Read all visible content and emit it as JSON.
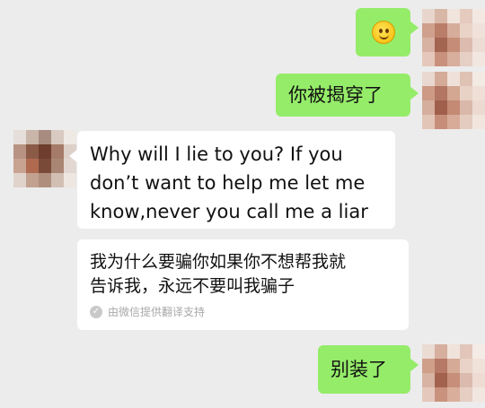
{
  "chat": {
    "messages": [
      {
        "side": "right",
        "type": "emoji",
        "emoji": "smile-emoji"
      },
      {
        "side": "right",
        "type": "text",
        "text": "你被揭穿了"
      },
      {
        "side": "left",
        "type": "text",
        "lines": [
          "Why will I lie to you? If you",
          "don’t want to help me let me",
          "know,never you call me a liar"
        ]
      },
      {
        "side": "left",
        "type": "translation",
        "lines": [
          "我为什么要骗你如果你不想帮我就",
          "告诉我，永远不要叫我骗子"
        ],
        "caption": "由微信提供翻译支持"
      },
      {
        "side": "right",
        "type": "text",
        "text": "别装了"
      }
    ]
  },
  "colors": {
    "background": "#ececec",
    "outgoing_bubble": "#95ec69",
    "incoming_bubble": "#ffffff"
  },
  "icons": {
    "emoji": "smile-emoji",
    "caption_check": "check-circle-icon",
    "avatar": "pixelated-avatar"
  }
}
